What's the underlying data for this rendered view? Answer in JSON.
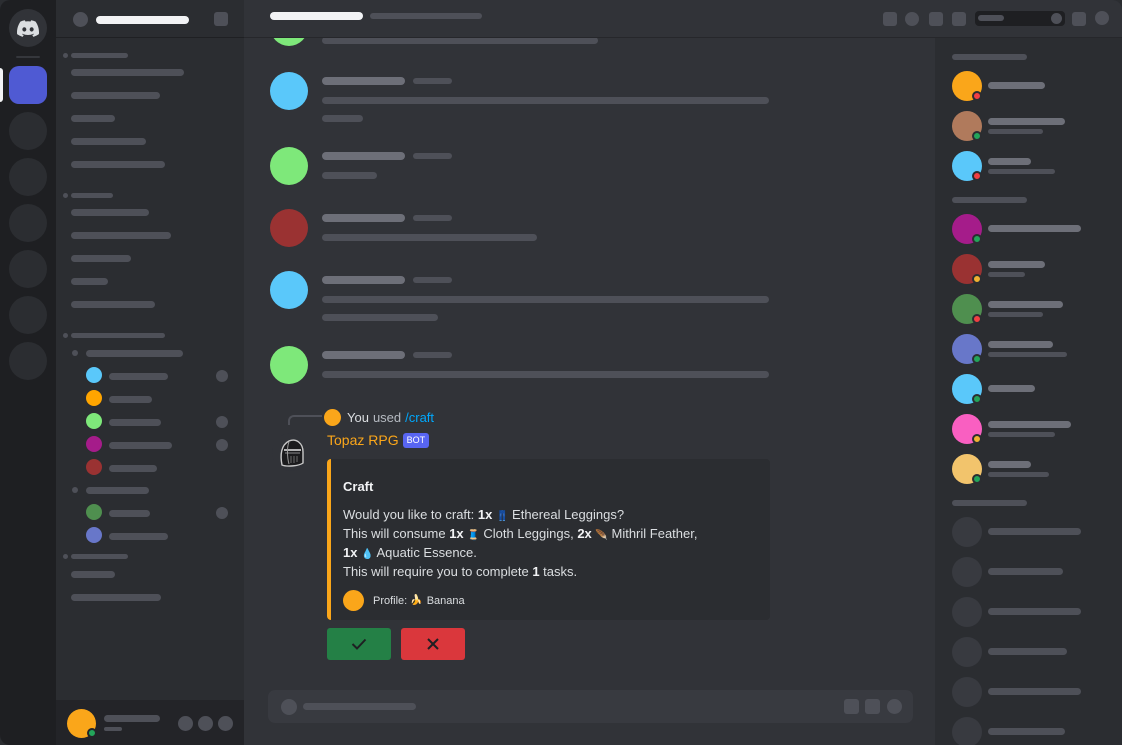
{
  "colors": {
    "accent": "#5865f2",
    "bot_color": "#faa61a",
    "confirm": "#248046",
    "cancel": "#da373c",
    "online": "#23a55a",
    "dnd": "#f23f43",
    "idle": "#f0b232"
  },
  "icons": {
    "home": "discord-logo-icon",
    "confirm": "checkmark-icon",
    "cancel": "close-icon",
    "leggings": "ethereal-leggings-icon",
    "cloth": "cloth-leggings-icon",
    "feather": "mithril-feather-icon",
    "essence": "aquatic-essence-icon",
    "banana": "banana-icon"
  },
  "message": {
    "reply_user": "You",
    "reply_used": "used",
    "reply_command": "/craft",
    "author": "Topaz RPG",
    "author_badge": "BOT",
    "embed": {
      "title": "Craft",
      "line1_prefix": "Would you like to craft: ",
      "line1_qty": "1x",
      "line1_item": "Ethereal Leggings?",
      "line2_prefix": "This will consume ",
      "line2_qty1": "1x",
      "line2_item1": "Cloth Leggings, ",
      "line2_qty2": "2x",
      "line2_item2": "Mithril Feather,",
      "line3_qty": "1x",
      "line3_item": "Aquatic Essence.",
      "line4_prefix": "This will require you to complete ",
      "line4_count": "1",
      "line4_suffix": " tasks.",
      "footer_label": "Profile: ",
      "footer_value": "Banana"
    }
  }
}
